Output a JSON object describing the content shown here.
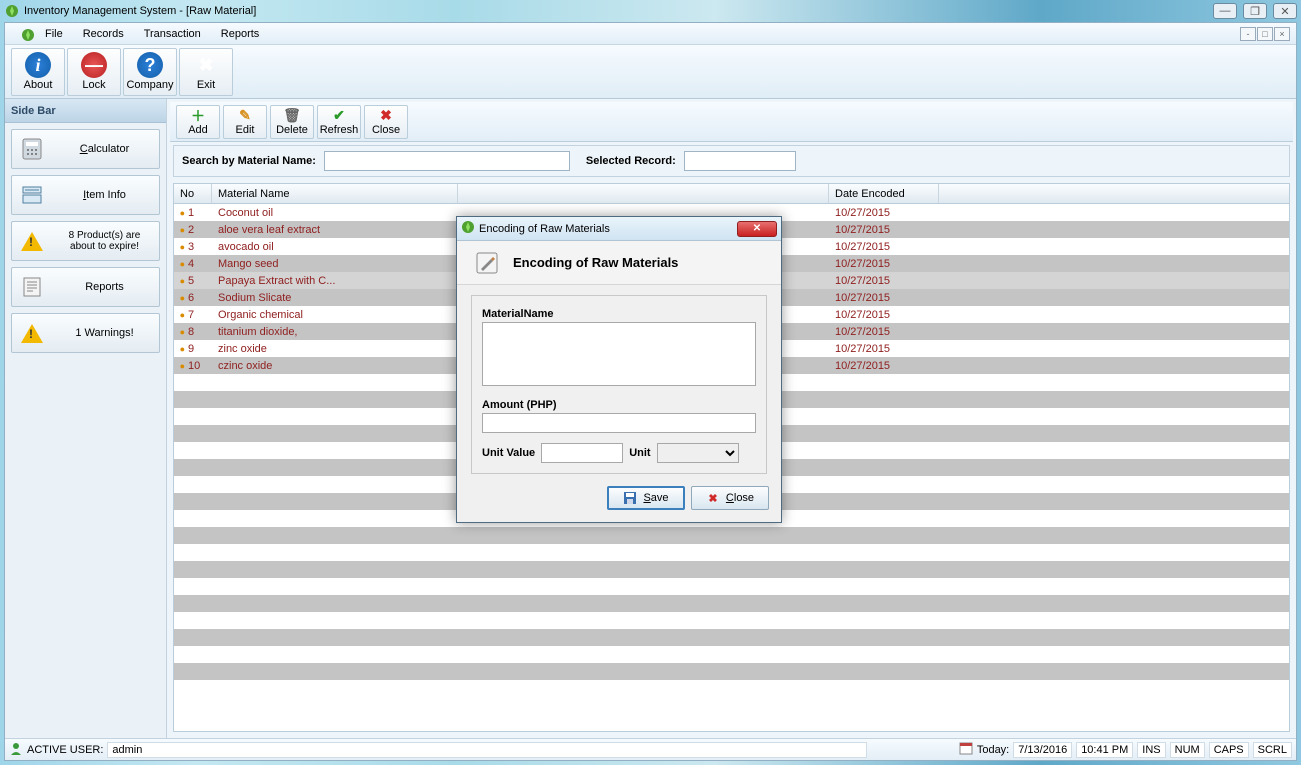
{
  "window": {
    "title": "Inventory Management System - [Raw Material]"
  },
  "menu": {
    "file": "File",
    "records": "Records",
    "transaction": "Transaction",
    "reports": "Reports"
  },
  "main_tb": {
    "about": "About",
    "lock": "Lock",
    "company": "Company",
    "exit": "Exit"
  },
  "sidebar": {
    "title": "Side Bar",
    "calculator": "Calculator",
    "iteminfo": "Item Info",
    "expire": "8 Product(s) are\nabout to expire!",
    "reports": "Reports",
    "warnings": "1 Warnings!"
  },
  "content_tb": {
    "add": "Add",
    "edit": "Edit",
    "delete": "Delete",
    "refresh": "Refresh",
    "close": "Close"
  },
  "search": {
    "label": "Search by Material Name:",
    "selected": "Selected Record:",
    "q": "",
    "record": ""
  },
  "grid": {
    "headers": {
      "no": "No",
      "name": "Material Name",
      "amt": "",
      "date": "Date Encoded"
    },
    "rows": [
      {
        "no": "1",
        "name": "Coconut oil",
        "date": "10/27/2015"
      },
      {
        "no": "2",
        "name": "aloe vera leaf extract",
        "date": "10/27/2015"
      },
      {
        "no": "3",
        "name": "avocado oil",
        "date": "10/27/2015"
      },
      {
        "no": "4",
        "name": "Mango seed",
        "date": "10/27/2015"
      },
      {
        "no": "5",
        "name": " Papaya Extract with C...",
        "date": "10/27/2015",
        "sel": true
      },
      {
        "no": "6",
        "name": "Sodium Slicate",
        "date": "10/27/2015"
      },
      {
        "no": "7",
        "name": "Organic chemical",
        "date": "10/27/2015"
      },
      {
        "no": "8",
        "name": "titanium dioxide,",
        "date": "10/27/2015"
      },
      {
        "no": "9",
        "name": "zinc oxide",
        "date": "10/27/2015"
      },
      {
        "no": "10",
        "name": "czinc oxide",
        "date": "10/27/2015"
      }
    ]
  },
  "dialog": {
    "title": "Encoding of Raw Materials",
    "header": "Encoding of Raw Materials",
    "material_label": "MaterialName",
    "material": "",
    "amount_label": "Amount (PHP)",
    "amount": "",
    "unitval_label": "Unit Value",
    "unitval": "",
    "unit_label": "Unit",
    "unit": "",
    "save": "Save",
    "close": "Close"
  },
  "status": {
    "activeuser_label": "ACTIVE USER:",
    "activeuser": "admin",
    "today_label": "Today:",
    "date": "7/13/2016",
    "time": "10:41 PM",
    "ins": "INS",
    "num": "NUM",
    "caps": "CAPS",
    "scrl": "SCRL"
  }
}
